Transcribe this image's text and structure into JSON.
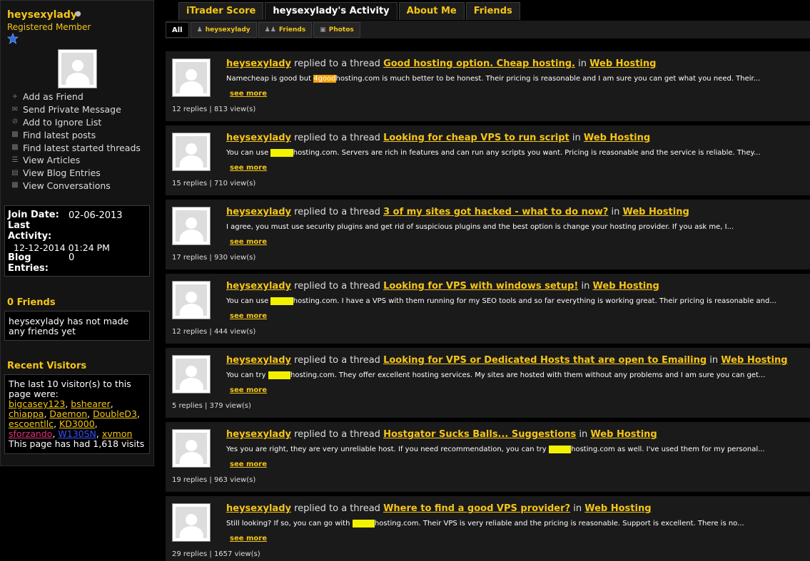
{
  "profile": {
    "username": "heysexylady",
    "rank": "Registered Member",
    "colors": {
      "accent": "#f5c518",
      "background": "#000000",
      "panel": "#1a1a1a",
      "highlight": "#f2f200",
      "star": "#2d6bd6"
    }
  },
  "actions": [
    {
      "icon": "plus-icon",
      "label": "Add as Friend"
    },
    {
      "icon": "envelope-icon",
      "label": "Send Private Message"
    },
    {
      "icon": "ignore-icon",
      "label": "Add to Ignore List"
    },
    {
      "icon": "posts-icon",
      "label": "Find latest posts"
    },
    {
      "icon": "threads-icon",
      "label": "Find latest started threads"
    },
    {
      "icon": "articles-icon",
      "label": "View Articles"
    },
    {
      "icon": "blog-icon",
      "label": "View Blog Entries"
    },
    {
      "icon": "conversations-icon",
      "label": "View Conversations"
    }
  ],
  "info": {
    "join_label": "Join Date:",
    "join_value": "02-06-2013",
    "last_label_1": "Last",
    "last_label_2": "Activity:",
    "last_value": "12-12-2014 01:24 PM",
    "blog_label_1": "Blog",
    "blog_label_2": "Entries:",
    "blog_value": "0"
  },
  "friends": {
    "title": "0 Friends",
    "empty_text": "heysexylady has not made any friends yet"
  },
  "visitors": {
    "title": "Recent Visitors",
    "intro": "The last 10 visitor(s) to this page were:",
    "names": [
      "bigcasey123",
      "bshearer",
      "chiappa",
      "Daemon",
      "DoubleD3",
      "escoentllc",
      "KD3000",
      "sforzando",
      "W130SN",
      "xvmon"
    ],
    "footer": "This page has had 1,618 visits"
  },
  "tabs": [
    "iTrader Score",
    "heysexylady's Activity",
    "About Me",
    "Friends"
  ],
  "subtabs": [
    {
      "label": "All",
      "icon": ""
    },
    {
      "label": "heysexylady",
      "icon": "user-icon"
    },
    {
      "label": "Friends",
      "icon": "friends-icon"
    },
    {
      "label": "Photos",
      "icon": "photos-icon"
    }
  ],
  "activity": {
    "verb": "replied to a thread",
    "in": "in",
    "see_more": "see more",
    "items": [
      {
        "user": "heysexylady",
        "thread": "Good hosting option. Cheap hosting.",
        "forum": "Web Hosting",
        "pre": "Namecheap is good but ",
        "hl": "4good",
        "post": "hosting.com is much better to be honest. Their pricing is reasonable and I am sure you can get what you need. Their...",
        "stats": "12 replies | 813 view(s)"
      },
      {
        "user": "heysexylady",
        "thread": "Looking for cheap VPS to run script",
        "forum": "Web Hosting",
        "pre": "You can use ",
        "hl": "4good",
        "post": "hosting.com. Servers are rich in features and can run any scripts you want. Pricing is reasonable and the service is reliable. They...",
        "stats": "15 replies | 710 view(s)"
      },
      {
        "user": "heysexylady",
        "thread": "3 of my sites got hacked - what to do now?",
        "forum": "Web Hosting",
        "pre": "I agree, you must use security plugins and get rid of suspicious plugins and the best option is change your hosting provider. If you ask me, I...",
        "hl": "",
        "post": "",
        "stats": "17 replies | 930 view(s)"
      },
      {
        "user": "heysexylady",
        "thread": "Looking for VPS with windows setup!",
        "forum": "Web Hosting",
        "pre": "You can use ",
        "hl": "4good",
        "post": "hosting.com. I have a VPS with them running for my SEO tools and so far everything is working great. Their pricing is reasonable and...",
        "stats": "12 replies | 444 view(s)"
      },
      {
        "user": "heysexylady",
        "thread": "Looking for VPS or Dedicated Hosts that are open to Emailing",
        "forum": "Web Hosting",
        "pre": "You can try ",
        "hl": "4good",
        "post": "hosting.com. They offer excellent hosting services. My sites are hosted with them without any problems and I am sure you can get...",
        "stats": "5 replies | 379 view(s)"
      },
      {
        "user": "heysexylady",
        "thread": "Hostgator Sucks Balls... Suggestions",
        "forum": "Web Hosting",
        "pre": "Yes you are right, they are very unreliable host. If you need recommendation, you can try ",
        "hl": "4good",
        "post": "hosting.com as well. I've used them for my personal...",
        "stats": "19 replies | 963 view(s)"
      },
      {
        "user": "heysexylady",
        "thread": "Where to find a good VPS provider?",
        "forum": "Web Hosting",
        "pre": "Still looking? If so, you can go with ",
        "hl": "4good",
        "post": "hosting.com. Their VPS is very reliable and the pricing is reasonable. Support is excellent. There is no...",
        "stats": "29 replies | 1657 view(s)"
      }
    ]
  }
}
